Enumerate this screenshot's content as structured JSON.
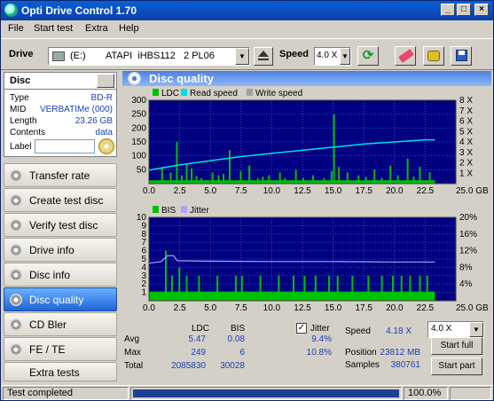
{
  "window": {
    "title": "Opti Drive Control 1.70"
  },
  "menu": [
    "File",
    "Start test",
    "Extra",
    "Help"
  ],
  "toolbar": {
    "drive_label": "Drive",
    "drive_letter": "(E:)",
    "drive_name": "ATAPI  iHBS112   2 PL06",
    "speed_label": "Speed",
    "speed_value": "4.0 X"
  },
  "disc": {
    "header": "Disc",
    "type_label": "Type",
    "type": "BD-R",
    "mid_label": "MID",
    "mid": "VERBATIMe (000)",
    "length_label": "Length",
    "length": "23.26 GB",
    "contents_label": "Contents",
    "contents": "data",
    "label_label": "Label",
    "label_value": ""
  },
  "nav": [
    "Transfer rate",
    "Create test disc",
    "Verify test disc",
    "Drive info",
    "Disc info",
    "Disc quality",
    "CD Bler",
    "FE / TE",
    "Extra tests"
  ],
  "nav_active": "Disc quality",
  "panel": {
    "title": "Disc quality"
  },
  "chart_data": [
    {
      "type": "line",
      "legend": [
        "LDC",
        "Read speed",
        "Write speed"
      ],
      "colors": {
        "LDC": "#00c000",
        "Read speed": "#00e0e0",
        "Write speed": "#a0a0a0"
      },
      "x_ticks": [
        "0.0",
        "2.5",
        "5.0",
        "7.5",
        "10.0",
        "12.5",
        "15.0",
        "17.5",
        "20.0",
        "22.5",
        "25.0 GB"
      ],
      "y_ticks_left": [
        "300",
        "250",
        "200",
        "150",
        "100",
        "50"
      ],
      "y_ticks_right": [
        "8 X",
        "7 X",
        "6 X",
        "5 X",
        "4 X",
        "3 X",
        "2 X",
        "1 X"
      ],
      "xlim": [
        0,
        25
      ],
      "ylim": [
        0,
        300
      ],
      "y2lim": [
        0,
        8
      ],
      "ldc_spikes": [
        [
          1.0,
          60
        ],
        [
          1.7,
          40
        ],
        [
          2.2,
          150
        ],
        [
          2.6,
          30
        ],
        [
          3.0,
          70
        ],
        [
          3.4,
          55
        ],
        [
          4.2,
          20
        ],
        [
          5.1,
          40
        ],
        [
          5.6,
          30
        ],
        [
          6.5,
          120
        ],
        [
          7.4,
          45
        ],
        [
          8.1,
          65
        ],
        [
          8.8,
          20
        ],
        [
          9.7,
          30
        ],
        [
          10.6,
          40
        ],
        [
          11.0,
          20
        ],
        [
          11.9,
          50
        ],
        [
          12.5,
          20
        ],
        [
          13.3,
          30
        ],
        [
          14.2,
          20
        ],
        [
          14.8,
          45
        ],
        [
          15.0,
          249
        ],
        [
          15.4,
          60
        ],
        [
          16.1,
          40
        ],
        [
          17.0,
          30
        ],
        [
          17.6,
          25
        ],
        [
          18.3,
          50
        ],
        [
          18.9,
          20
        ],
        [
          19.6,
          65
        ],
        [
          20.2,
          30
        ],
        [
          21.0,
          90
        ],
        [
          21.5,
          25
        ],
        [
          22.0,
          60
        ],
        [
          22.8,
          40
        ],
        [
          3.8,
          28
        ],
        [
          6.0,
          35
        ],
        [
          9.2,
          25
        ]
      ],
      "read_speed": [
        [
          0.0,
          1.3
        ],
        [
          2.5,
          1.8
        ],
        [
          5.0,
          2.2
        ],
        [
          7.5,
          2.6
        ],
        [
          10.0,
          2.9
        ],
        [
          12.5,
          3.2
        ],
        [
          15.0,
          3.5
        ],
        [
          17.5,
          3.8
        ],
        [
          20.0,
          4.0
        ],
        [
          22.5,
          4.2
        ],
        [
          23.3,
          4.2
        ]
      ]
    },
    {
      "type": "line",
      "legend": [
        "BIS",
        "Jitter"
      ],
      "colors": {
        "BIS": "#00c000",
        "Jitter": "#b0a0ff"
      },
      "x_ticks": [
        "0.0",
        "2.5",
        "5.0",
        "7.5",
        "10.0",
        "12.5",
        "15.0",
        "17.5",
        "20.0",
        "22.5",
        "25.0 GB"
      ],
      "y_ticks_left": [
        "10",
        "9",
        "8",
        "7",
        "6",
        "5",
        "4",
        "3",
        "2",
        "1"
      ],
      "y_ticks_right": [
        "20%",
        "16%",
        "12%",
        "8%",
        "4%"
      ],
      "xlim": [
        0,
        25
      ],
      "ylim": [
        0,
        10
      ],
      "y2lim": [
        0,
        20
      ],
      "bis_spikes": [
        [
          1.3,
          6
        ],
        [
          1.8,
          3
        ],
        [
          2.4,
          4
        ],
        [
          3.0,
          3
        ],
        [
          4.0,
          3
        ],
        [
          5.5,
          3
        ],
        [
          7.0,
          3
        ],
        [
          7.5,
          3
        ],
        [
          9.0,
          3
        ],
        [
          10.5,
          3
        ],
        [
          11.7,
          3
        ],
        [
          12.6,
          3
        ],
        [
          13.5,
          3
        ],
        [
          14.6,
          3
        ],
        [
          15.3,
          3
        ],
        [
          16.5,
          3
        ],
        [
          17.8,
          3
        ],
        [
          18.9,
          3
        ],
        [
          19.8,
          3
        ],
        [
          20.5,
          3
        ],
        [
          21.2,
          3
        ],
        [
          22.0,
          3
        ],
        [
          22.6,
          3
        ]
      ],
      "jitter": [
        [
          0.0,
          9.0
        ],
        [
          1.0,
          9.4
        ],
        [
          1.5,
          10.8
        ],
        [
          2.0,
          10.8
        ],
        [
          2.3,
          9.6
        ],
        [
          5.0,
          9.5
        ],
        [
          10.0,
          9.4
        ],
        [
          15.0,
          9.4
        ],
        [
          20.0,
          9.3
        ],
        [
          23.3,
          9.3
        ]
      ]
    }
  ],
  "stats": {
    "col_ldc": "LDC",
    "col_bis": "BIS",
    "avg_label": "Avg",
    "avg_ldc": "5.47",
    "avg_bis": "0.08",
    "max_label": "Max",
    "max_ldc": "249",
    "max_bis": "6",
    "total_label": "Total",
    "total_ldc": "2085830",
    "total_bis": "30028",
    "jitter_label": "Jitter",
    "jitter_avg": "9.4%",
    "jitter_max": "10.8%",
    "speed_label": "Speed",
    "speed": "4.18 X",
    "speed_select": "4.0 X",
    "position_label": "Position",
    "position": "23812 MB",
    "samples_label": "Samples",
    "samples": "380761",
    "start_full": "Start full",
    "start_part": "Start part"
  },
  "status": {
    "text": "Test completed",
    "progress": "100.0%",
    "progress_fraction": 1.0,
    "time": ""
  }
}
